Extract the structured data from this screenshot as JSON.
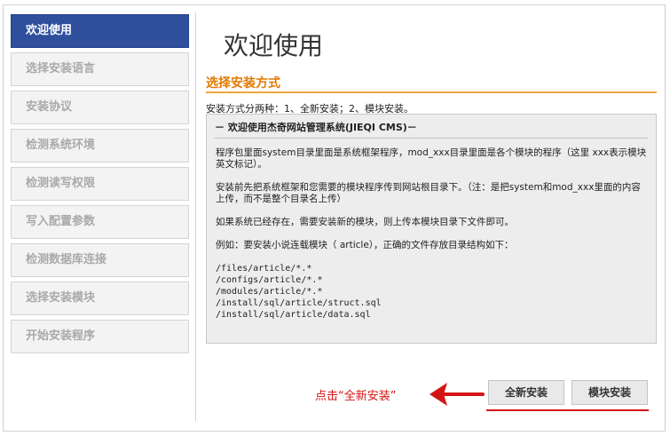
{
  "sidebar": {
    "items": [
      {
        "label": "欢迎使用",
        "active": true
      },
      {
        "label": "选择安装语言",
        "active": false
      },
      {
        "label": "安装协议",
        "active": false
      },
      {
        "label": "检测系统环境",
        "active": false
      },
      {
        "label": "检测读写权限",
        "active": false
      },
      {
        "label": "写入配置参数",
        "active": false
      },
      {
        "label": "检测数据库连接",
        "active": false
      },
      {
        "label": "选择安装模块",
        "active": false
      },
      {
        "label": "开始安装程序",
        "active": false
      }
    ]
  },
  "main": {
    "title": "欢迎使用",
    "section_title": "选择安装方式",
    "intro": "安装方式分两种：1、全新安装；2、模块安装。",
    "box": {
      "heading": "－ 欢迎使用杰奇网站管理系统(JIEQI CMS)－",
      "p1": "程序包里面system目录里面是系统框架程序，mod_xxx目录里面是各个模块的程序（这里 xxx表示模块英文标记）。",
      "p2": "安装前先把系统框架和您需要的模块程序传到网站根目录下。（注：是把system和mod_xxx里面的内容上传，而不是整个目录名上传）",
      "p3": "如果系统已经存在，需要安装新的模块，则上传本模块目录下文件即可。",
      "p4": "例如：要安装小说连载模块（ article），正确的文件存放目录结构如下：",
      "paths": [
        "/files/article/*.*",
        "/configs/article/*.*",
        "/modules/article/*.*",
        "/install/sql/article/struct.sql",
        "/install/sql/article/data.sql"
      ]
    }
  },
  "annotation": {
    "hint": "点击“全新安装”",
    "color": "#d41414"
  },
  "buttons": {
    "new_install": "全新安装",
    "module_install": "模块安装"
  },
  "colors": {
    "sidebar_active": "#2f4f9d",
    "section_title": "#e27a00",
    "accent_rule": "#f0a640"
  },
  "icons": {
    "arrow": "arrow-left-icon"
  }
}
